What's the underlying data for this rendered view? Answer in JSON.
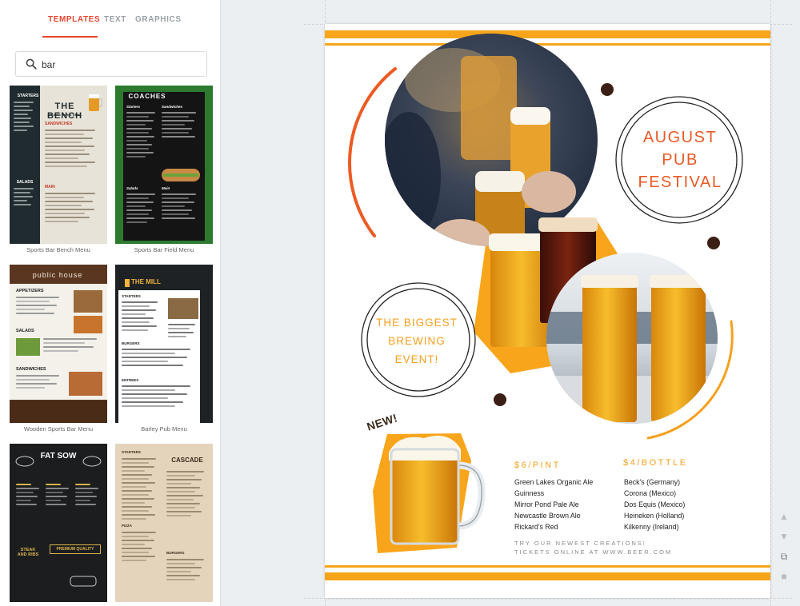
{
  "panel": {
    "tabs": [
      {
        "label": "TEMPLATES",
        "active": true
      },
      {
        "label": "TEXT",
        "active": false
      },
      {
        "label": "GRAPHICS",
        "active": false
      }
    ],
    "search": {
      "value": "bar",
      "icon": "search-icon"
    },
    "templates": [
      {
        "caption": "Sports Bar Bench Menu",
        "title": "THE BENCH",
        "subtitle": "SPORTS BAR & GRILL",
        "heading_left": "STARTERS",
        "heading_main": "SANDWICHES",
        "heading_2": "SALADS",
        "heading_3": "MAIN"
      },
      {
        "caption": "Sports Bar Field Menu",
        "title": "COACHES",
        "heading_left": "Starters",
        "heading_main": "Sandwiches",
        "heading_2": "Salads",
        "heading_3": "Main"
      },
      {
        "caption": "Wooden Sports Bar Menu",
        "title": "public house",
        "heading_left": "APPETIZERS",
        "heading_2": "SALADS",
        "heading_3": "SANDWICHES"
      },
      {
        "caption": "Barley Pub Menu",
        "title": "THE MILL",
        "heading_left": "STARTERS",
        "heading_2": "BURGERS",
        "heading_3": "ENTREES"
      },
      {
        "caption": "",
        "title": "FAT SOW",
        "badge": "PREMIUM QUALITY",
        "footer": "STEAK AND RIBS"
      },
      {
        "caption": "",
        "title": "CASCADE",
        "heading_left": "STARTERS",
        "heading_2": "PIZZA",
        "heading_3": "BURGERS"
      }
    ]
  },
  "flyer": {
    "festival_lines": [
      "AUGUST",
      "PUB",
      "FESTIVAL"
    ],
    "event_lines": [
      "THE BIGGEST",
      "BREWING",
      "EVENT!"
    ],
    "new_label": "NEW!",
    "pint_header": "$6/PINT",
    "pint_beers": [
      "Green Lakes Organic Ale",
      "Guinness",
      "Mirror Pond Pale Ale",
      "Newcastle Brown Ale",
      "Rickard's Red"
    ],
    "bottle_header": "$4/BOTTLE",
    "bottle_beers": [
      "Beck's (Germany)",
      "Corona (Mexico)",
      "Dos Equis (Mexico)",
      "Heineken (Holland)",
      "Kilkenny (Ireland)"
    ],
    "promo_line_1": "TRY OUR NEWEST CREATIONS!",
    "promo_line_2": "TICKETS ONLINE AT WWW.BEER.COM"
  },
  "colors": {
    "accent_red": "#e8452f",
    "orange": "#f9a51b",
    "festival_text": "#ea5a26",
    "dark_dot": "#3b1f14"
  },
  "side_tools": [
    "arrow-up-icon",
    "arrow-down-icon",
    "duplicate-icon",
    "trash-icon"
  ]
}
